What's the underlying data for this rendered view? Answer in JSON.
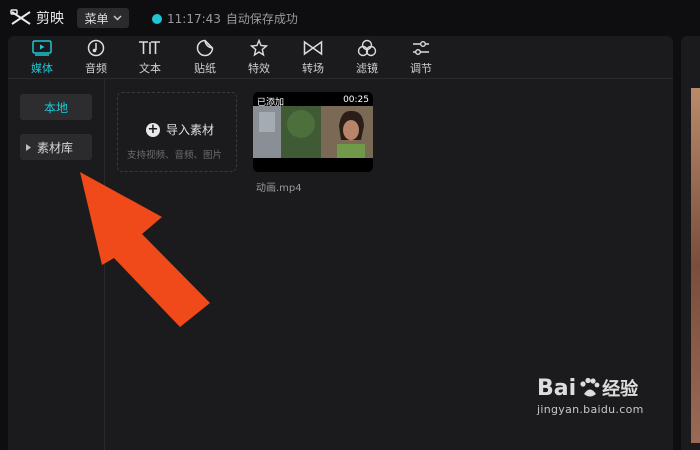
{
  "app": {
    "name": "剪映"
  },
  "header": {
    "menu_label": "菜单",
    "save_time": "11:17:43",
    "save_text": "自动保存成功"
  },
  "toolbar": {
    "items": [
      {
        "label": "媒体",
        "icon": "media-icon"
      },
      {
        "label": "音频",
        "icon": "audio-icon"
      },
      {
        "label": "文本",
        "icon": "text-icon"
      },
      {
        "label": "贴纸",
        "icon": "sticker-icon"
      },
      {
        "label": "特效",
        "icon": "effects-icon"
      },
      {
        "label": "转场",
        "icon": "transition-icon"
      },
      {
        "label": "滤镜",
        "icon": "filter-icon"
      },
      {
        "label": "调节",
        "icon": "adjust-icon"
      }
    ],
    "active": "媒体"
  },
  "sidebar": {
    "items": [
      {
        "label": "本地"
      },
      {
        "label": "素材库"
      }
    ]
  },
  "import": {
    "label": "导入素材",
    "hint": "支持视频、音频、图片"
  },
  "clip": {
    "badge": "已添加",
    "duration": "00:25",
    "name": "动画.mp4"
  },
  "watermark": {
    "main": "Bai",
    "brand": "经验",
    "url": "jingyan.baidu.com"
  },
  "colors": {
    "accent": "#1fc7d4",
    "arrow": "#f04a1a"
  }
}
